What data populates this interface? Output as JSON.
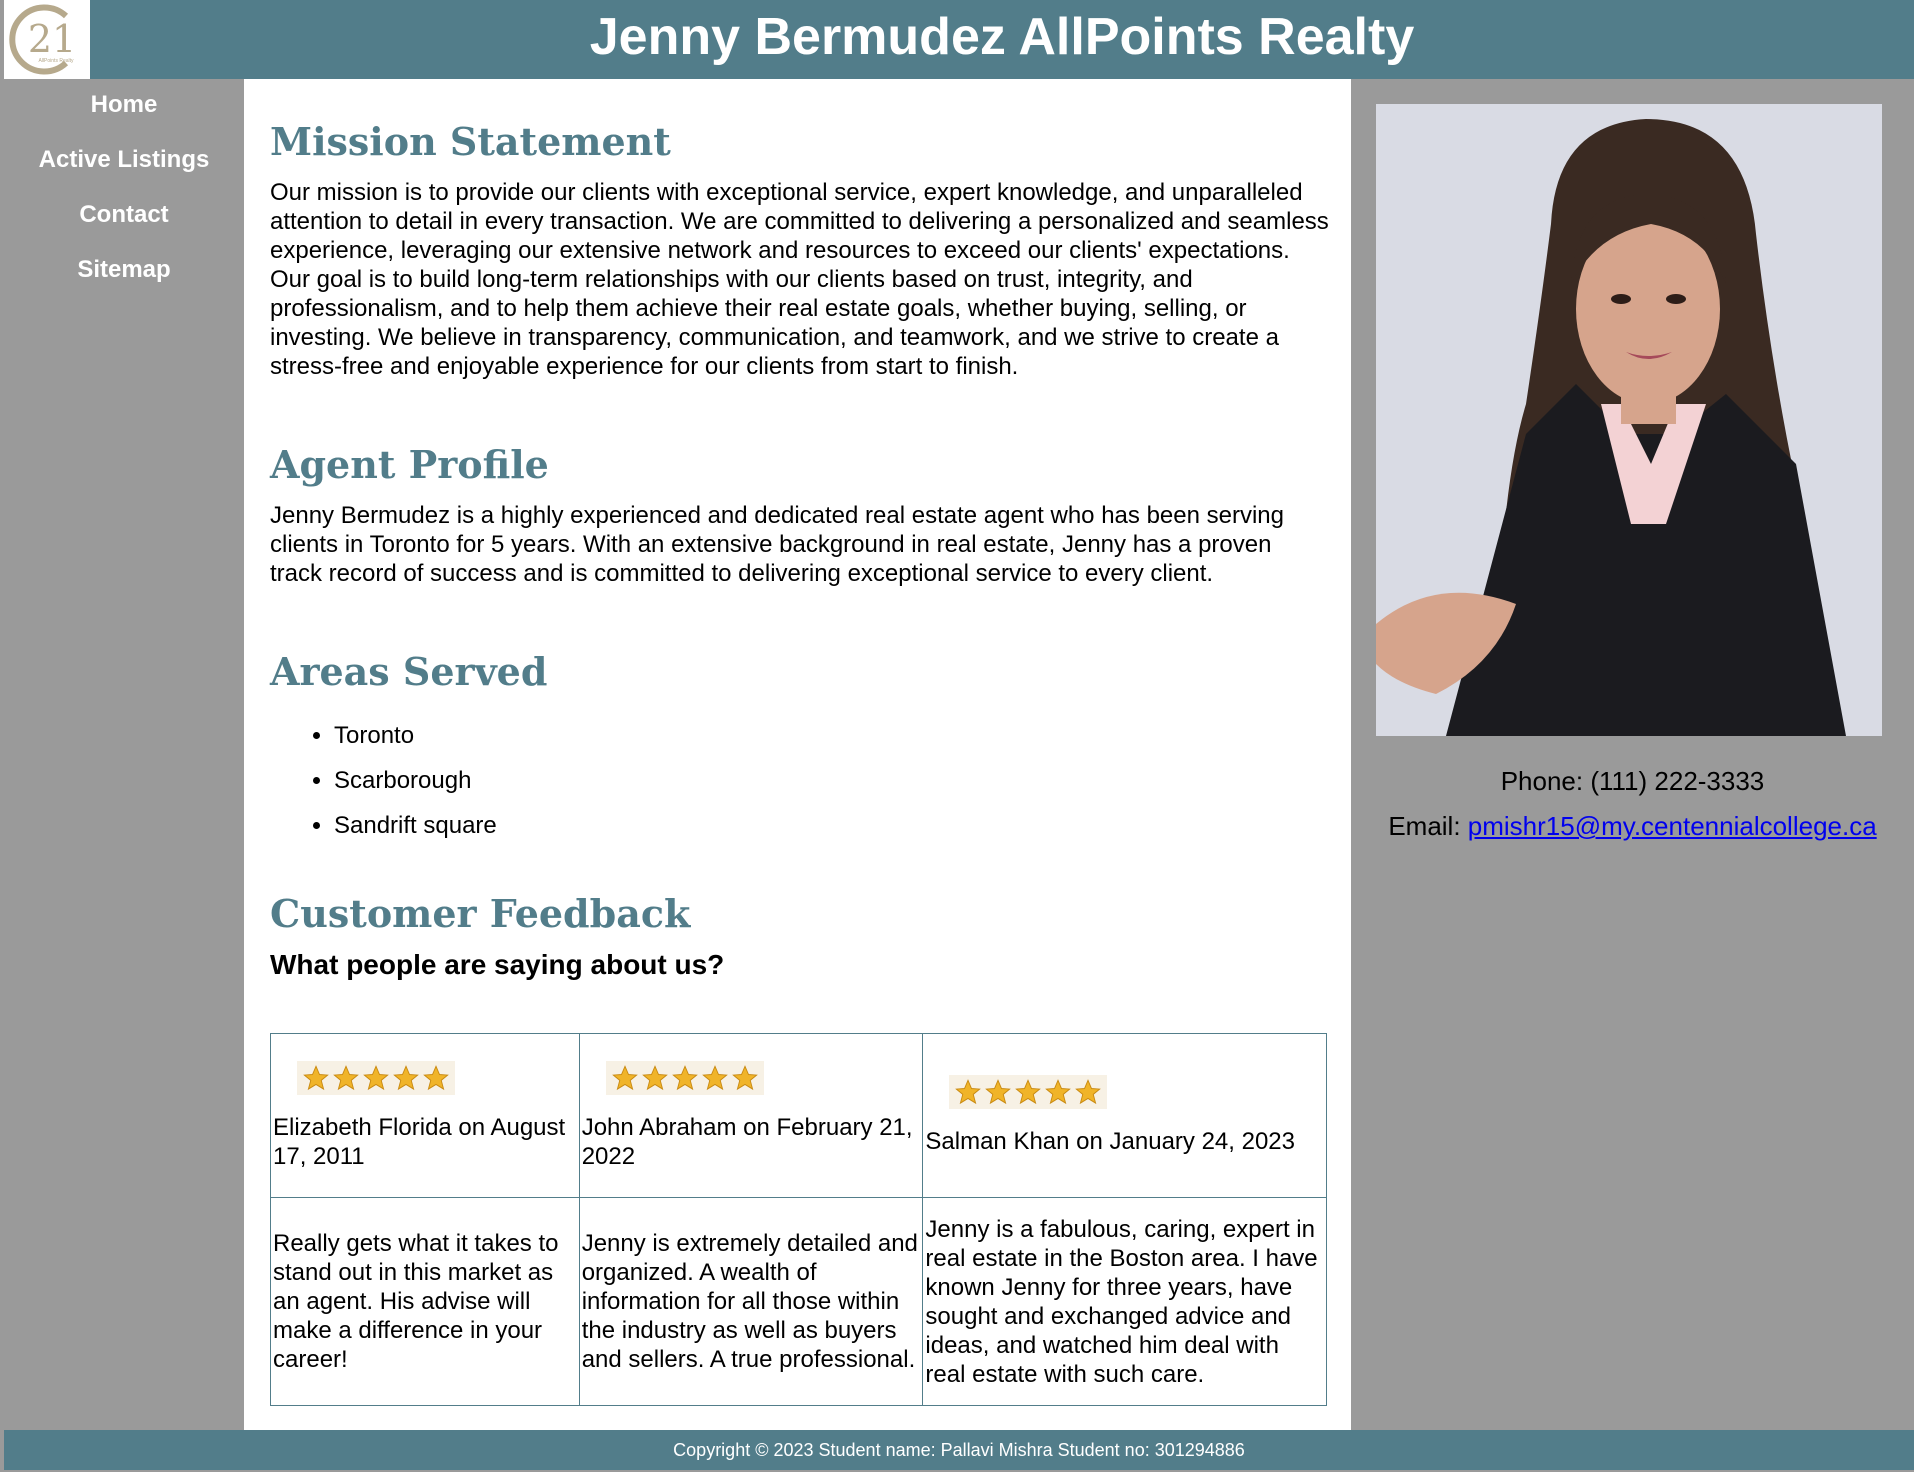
{
  "header": {
    "title": "Jenny Bermudez AllPoints Realty",
    "logo_text": "21",
    "logo_subtext": "AllPoints Realty"
  },
  "nav": {
    "items": [
      {
        "label": "Home"
      },
      {
        "label": "Active Listings"
      },
      {
        "label": "Contact"
      },
      {
        "label": "Sitemap"
      }
    ]
  },
  "main": {
    "mission": {
      "heading": "Mission Statement",
      "text": "Our mission is to provide our clients with exceptional service, expert knowledge, and unparalleled attention to detail in every transaction. We are committed to delivering a personalized and seamless experience, leveraging our extensive network and resources to exceed our clients' expectations. Our goal is to build long-term relationships with our clients based on trust, integrity, and professionalism, and to help them achieve their real estate goals, whether buying, selling, or investing. We believe in transparency, communication, and teamwork, and we strive to create a stress-free and enjoyable experience for our clients from start to finish."
    },
    "agent": {
      "heading": "Agent Profile",
      "text": "Jenny Bermudez is a highly experienced and dedicated real estate agent who has been serving clients in Toronto for 5 years. With an extensive background in real estate, Jenny has a proven track record of success and is committed to delivering exceptional service to every client."
    },
    "areas": {
      "heading": "Areas Served",
      "items": [
        "Toronto",
        "Scarborough",
        "Sandrift square"
      ]
    },
    "feedback": {
      "heading": "Customer Feedback",
      "subheading": "What people are saying about us?",
      "reviews": [
        {
          "author": "Elizabeth Florida on August 17, 2011",
          "rating": 5,
          "text": "Really gets what it takes to stand out in this market as an agent. His advise will make a difference in your career!"
        },
        {
          "author": "John Abraham on February 21, 2022",
          "rating": 5,
          "text": "Jenny is extremely detailed and organized. A wealth of information for all those within the industry as well as buyers and sellers. A true professional."
        },
        {
          "author": "Salman Khan on January 24, 2023",
          "rating": 5,
          "text": "Jenny is a fabulous, caring, expert in real estate in the Boston area. I have known Jenny for three years, have sought and exchanged advice and ideas, and watched him deal with real estate with such care."
        }
      ]
    }
  },
  "aside": {
    "phone_label": "Phone: (111) 222-3333",
    "email_label": "Email: ",
    "email": "pmishr15@my.centennialcollege.ca"
  },
  "footer": {
    "text": "Copyright © 2023 Student name: Pallavi Mishra Student no: 301294886"
  },
  "colors": {
    "brand": "#527d8a",
    "background": "#9a9a9a",
    "star": "#f0b429",
    "link": "#0000ee"
  }
}
